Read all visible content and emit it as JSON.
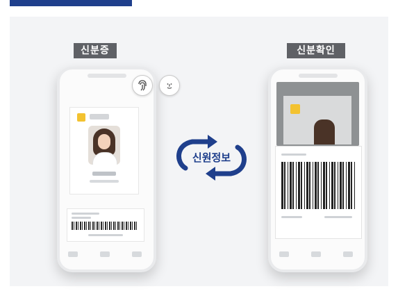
{
  "labels": {
    "left": "신분증",
    "right": "신분확인"
  },
  "center": {
    "text": "신원정보"
  },
  "colors": {
    "brand_blue": "#1f3f8c",
    "label_gray": "#5f6166",
    "panel_bg": "#f3f4f6",
    "emblem_yellow": "#f3c230"
  },
  "icons": {
    "fingerprint": "fingerprint-icon",
    "face": "face-id-icon",
    "sync": "sync-arrows-icon"
  }
}
